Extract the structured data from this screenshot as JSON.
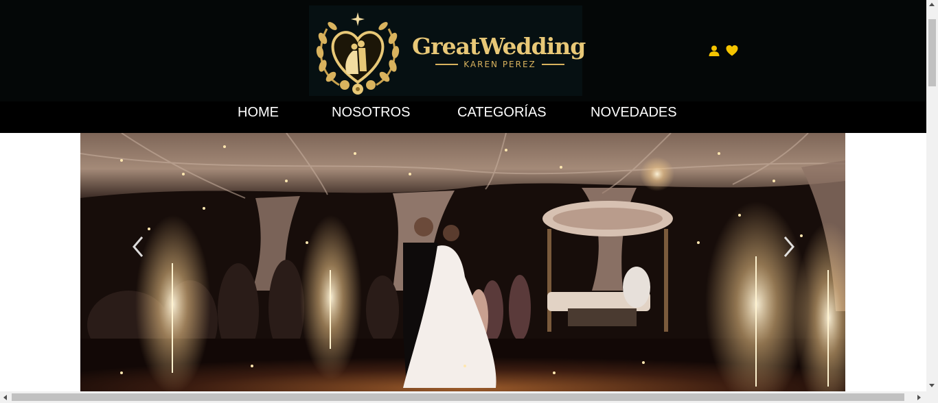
{
  "brand": {
    "title": "GreatWedding",
    "subtitle": "KAREN PEREZ",
    "emblem_icon": "heart-couple-emblem",
    "gold": "#e8c877",
    "header_bg": "#040707"
  },
  "header_icons": [
    {
      "name": "user-icon",
      "color": "#f5c400"
    },
    {
      "name": "heart-icon",
      "color": "#f5c400"
    }
  ],
  "nav": {
    "items": [
      {
        "label": "HOME"
      },
      {
        "label": "NOSOTROS"
      },
      {
        "label": "CATEGORÍAS"
      },
      {
        "label": "NOVEDADES"
      }
    ],
    "bg": "#000000"
  },
  "carousel": {
    "prev_icon": "chevron-left-icon",
    "next_icon": "chevron-right-icon"
  }
}
